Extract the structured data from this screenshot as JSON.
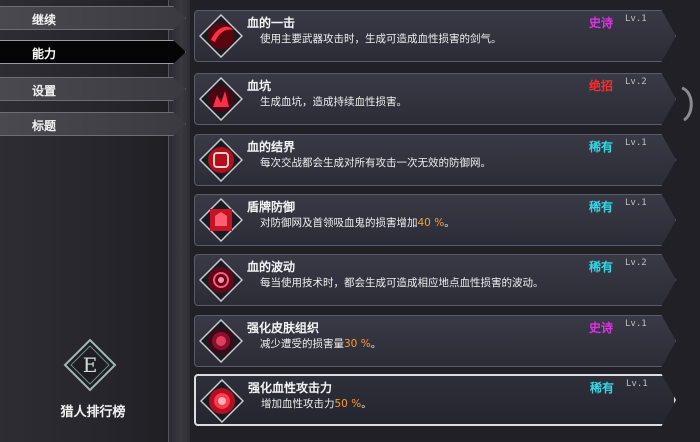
{
  "menu": {
    "items": [
      {
        "label": "继续",
        "active": false
      },
      {
        "label": "能力",
        "active": true
      },
      {
        "label": "设置",
        "active": false
      },
      {
        "label": "标题",
        "active": false
      }
    ]
  },
  "emblem": {
    "letter": "E"
  },
  "ranking": {
    "label": "猎人排行榜"
  },
  "colors": {
    "epic": "#e030e8",
    "legendary": "#ff2a2a",
    "rare": "#35d6e6",
    "highlight": "#ff9a2e"
  },
  "abilities": [
    {
      "title": "血的一击",
      "rarity": "史诗",
      "rarity_color": "#e030e8",
      "level": "Lv.1",
      "desc_pre": "使用主要武器攻击时，生成可造成血性损害的剑气。",
      "desc_hl": "",
      "desc_post": ""
    },
    {
      "title": "血坑",
      "rarity": "绝招",
      "rarity_color": "#ff2a2a",
      "level": "Lv.2",
      "desc_pre": "生成血坑，造成持续血性损害。",
      "desc_hl": "",
      "desc_post": ""
    },
    {
      "title": "血的结界",
      "rarity": "稀有",
      "rarity_color": "#35d6e6",
      "level": "Lv.1",
      "desc_pre": "每次交战都会生成对所有攻击一次无效的防御网。",
      "desc_hl": "",
      "desc_post": ""
    },
    {
      "title": "盾牌防御",
      "rarity": "稀有",
      "rarity_color": "#35d6e6",
      "level": "Lv.1",
      "desc_pre": "对防御网及首领吸血鬼的损害增加",
      "desc_hl": "40 %",
      "desc_post": "。"
    },
    {
      "title": "血的波动",
      "rarity": "稀有",
      "rarity_color": "#35d6e6",
      "level": "Lv.2",
      "desc_pre": "每当使用技术时，都会生成可造成相应地点血性损害的波动。",
      "desc_hl": "",
      "desc_post": ""
    },
    {
      "title": "强化皮肤组织",
      "rarity": "史诗",
      "rarity_color": "#e030e8",
      "level": "Lv.1",
      "desc_pre": "减少遭受的损害量",
      "desc_hl": "30 %",
      "desc_post": "。"
    },
    {
      "title": "强化血性攻击力",
      "rarity": "稀有",
      "rarity_color": "#35d6e6",
      "level": "Lv.1",
      "desc_pre": "增加血性攻击力",
      "desc_hl": "50 %",
      "desc_post": "。"
    }
  ]
}
